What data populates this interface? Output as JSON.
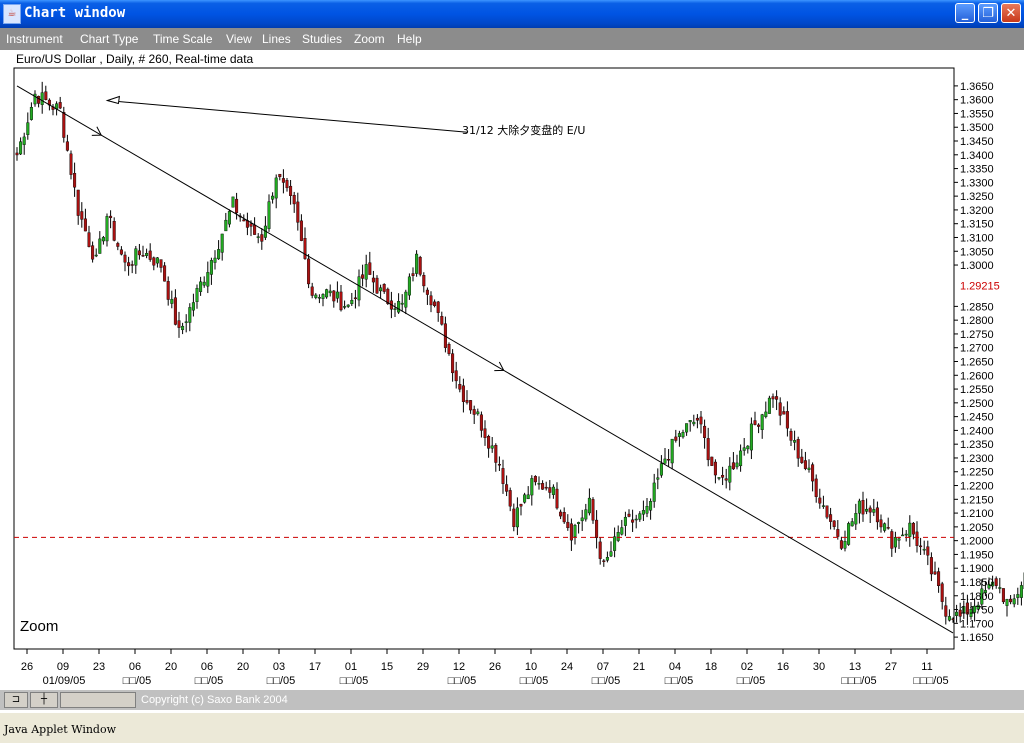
{
  "window": {
    "title": "Chart window",
    "icon": "java-cup-icon",
    "controls": {
      "minimize": "_",
      "maximize": "❐",
      "close": "✕"
    }
  },
  "menu": [
    "Instrument",
    "Chart Type",
    "Time Scale",
    "View",
    "Lines",
    "Studies",
    "Zoom",
    "Help"
  ],
  "info_line": "Euro/US Dollar , Daily, # 260, Real-time data",
  "zoom_label": "Zoom",
  "annotation_text": "31/12 大除夕变盘的 E/U",
  "bottom_bar": {
    "copyright": "Copyright (c) Saxo Bank 2004",
    "tool1_icon": "pin-icon",
    "tool2_icon": "crosshair-icon"
  },
  "status_bar": "Java Applet Window",
  "colors": {
    "up_candle": "#22aa22",
    "down_candle": "#aa1111",
    "current_price_line": "#cc0000",
    "menubar": "#8c8c8c",
    "titlebar": "#0054e3"
  },
  "chart_data": {
    "type": "candlestick",
    "instrument": "Euro/US Dollar",
    "timeframe": "Daily",
    "ylim": [
      1.1625,
      1.3675
    ],
    "y_ticks": [
      "1.3650",
      "1.3600",
      "1.3550",
      "1.3500",
      "1.3450",
      "1.3400",
      "1.3350",
      "1.3300",
      "1.3250",
      "1.3200",
      "1.3150",
      "1.3100",
      "1.3050",
      "1.3000",
      "1.2850",
      "1.2800",
      "1.2750",
      "1.2700",
      "1.2650",
      "1.2600",
      "1.2550",
      "1.2500",
      "1.2450",
      "1.2400",
      "1.2350",
      "1.2300",
      "1.2250",
      "1.2200",
      "1.2150",
      "1.2100",
      "1.2050",
      "1.2000",
      "1.1950",
      "1.1900",
      "1.1850",
      "1.1800",
      "1.1750",
      "1.1700",
      "1.1650"
    ],
    "current_price": 1.2012,
    "current_price_label": "1.29215",
    "x_ticks": [
      "26",
      "09",
      "23",
      "06",
      "20",
      "06",
      "20",
      "03",
      "17",
      "01",
      "15",
      "29",
      "12",
      "26",
      "10",
      "24",
      "07",
      "21",
      "04",
      "18",
      "02",
      "16",
      "30",
      "13",
      "27",
      "11"
    ],
    "month_labels": [
      "01/09/05",
      "□□/05",
      "□□/05",
      "□□/05",
      "□□/05",
      "□□/05",
      "□□/05",
      "□□/05",
      "□□/05",
      "□□/05",
      "□□□/05",
      "□□□/05"
    ],
    "path": [
      [
        0,
        1.34
      ],
      [
        5,
        1.362
      ],
      [
        12,
        1.356
      ],
      [
        17,
        1.32
      ],
      [
        22,
        1.301
      ],
      [
        25,
        1.318
      ],
      [
        30,
        1.3
      ],
      [
        35,
        1.305
      ],
      [
        40,
        1.3
      ],
      [
        45,
        1.275
      ],
      [
        50,
        1.29
      ],
      [
        55,
        1.305
      ],
      [
        60,
        1.322
      ],
      [
        65,
        1.312
      ],
      [
        68,
        1.31
      ],
      [
        72,
        1.333
      ],
      [
        77,
        1.32
      ],
      [
        82,
        1.29
      ],
      [
        86,
        1.29
      ],
      [
        92,
        1.285
      ],
      [
        97,
        1.298
      ],
      [
        102,
        1.288
      ],
      [
        107,
        1.285
      ],
      [
        111,
        1.302
      ],
      [
        116,
        1.285
      ],
      [
        123,
        1.255
      ],
      [
        128,
        1.245
      ],
      [
        134,
        1.228
      ],
      [
        138,
        1.208
      ],
      [
        143,
        1.22
      ],
      [
        148,
        1.22
      ],
      [
        154,
        1.203
      ],
      [
        159,
        1.213
      ],
      [
        163,
        1.19
      ],
      [
        168,
        1.205
      ],
      [
        175,
        1.21
      ],
      [
        180,
        1.23
      ],
      [
        185,
        1.24
      ],
      [
        189,
        1.244
      ],
      [
        195,
        1.22
      ],
      [
        200,
        1.23
      ],
      [
        205,
        1.242
      ],
      [
        210,
        1.253
      ],
      [
        215,
        1.237
      ],
      [
        220,
        1.224
      ],
      [
        225,
        1.21
      ],
      [
        229,
        1.2
      ],
      [
        234,
        1.212
      ],
      [
        238,
        1.212
      ],
      [
        243,
        1.2
      ],
      [
        248,
        1.205
      ],
      [
        253,
        1.192
      ],
      [
        258,
        1.175
      ],
      [
        262,
        1.172
      ],
      [
        268,
        1.18
      ],
      [
        272,
        1.185
      ],
      [
        276,
        1.175
      ],
      [
        280,
        1.188
      ],
      [
        284,
        1.2
      ]
    ],
    "trendline": [
      [
        0,
        1.365
      ],
      [
        260,
        1.1665
      ]
    ],
    "annotation_line": [
      [
        4,
        1.3615
      ],
      [
        129,
        1.35
      ]
    ]
  }
}
